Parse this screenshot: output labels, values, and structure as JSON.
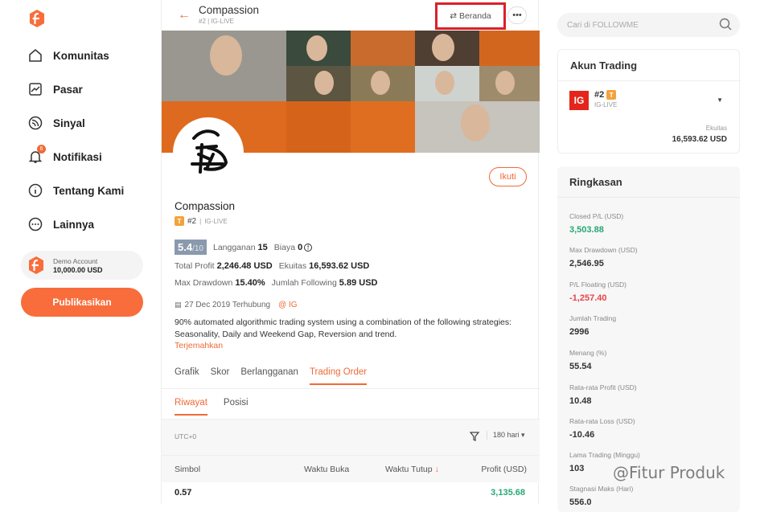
{
  "sidebar": {
    "items": [
      {
        "label": "Komunitas",
        "icon": "home-icon"
      },
      {
        "label": "Pasar",
        "icon": "chart-icon"
      },
      {
        "label": "Sinyal",
        "icon": "signal-icon"
      },
      {
        "label": "Notifikasi",
        "icon": "bell-icon",
        "badge": "6"
      },
      {
        "label": "Tentang Kami",
        "icon": "info-icon"
      },
      {
        "label": "Lainnya",
        "icon": "more-icon"
      }
    ],
    "demo_label": "Demo Account",
    "demo_value": "10,000.00 USD",
    "publish_label": "Publikasikan"
  },
  "header": {
    "title": "Compassion",
    "rank": "#2",
    "broker": "IG-LIVE",
    "home_label": "Beranda"
  },
  "profile": {
    "follow_label": "Ikuti",
    "name": "Compassion",
    "tier": "T",
    "rank": "#2",
    "broker": "IG-LIVE",
    "score": "5.4",
    "score_max": "/10",
    "subs_label": "Langganan",
    "subs_value": "15",
    "fee_label": "Biaya",
    "fee_value": "0",
    "total_profit_label": "Total Profit",
    "total_profit_value": "2,246.48 USD",
    "equity_label": "Ekuitas",
    "equity_value": "16,593.62 USD",
    "max_dd_label": "Max Drawdown",
    "max_dd_value": "15.40%",
    "following_label": "Jumlah Following",
    "following_value": "5.89 USD",
    "date_text": "27 Dec 2019 Terhubung",
    "ig_text": "@ IG",
    "description": "90% automated algorithmic trading system using a combination of the following strategies: Seasonality, Daily and Weekend Gap,  Reversion and trend.",
    "translate_label": "Terjemahkan"
  },
  "tabs": [
    "Grafik",
    "Skor",
    "Berlangganan",
    "Trading Order"
  ],
  "subtabs": [
    "Riwayat",
    "Posisi"
  ],
  "filter": {
    "timezone": "UTC+0",
    "period": "180 hari"
  },
  "table": {
    "headers": [
      "Simbol",
      "Waktu Buka",
      "Waktu Tutup",
      "Profit (USD)"
    ],
    "rows": [
      {
        "symbol": "0.57",
        "profit": "3,135.68"
      }
    ]
  },
  "right": {
    "search_placeholder": "Cari di FOLLOWME",
    "trading_account_title": "Akun Trading",
    "account_rank": "#2",
    "account_tier": "T",
    "account_broker": "IG-LIVE",
    "broker_logo": "IG",
    "equity_label": "Ekuitas",
    "equity_value": "16,593.62 USD",
    "summary_title": "Ringkasan",
    "metrics": [
      {
        "label": "Closed P/L (USD)",
        "value": "3,503.88",
        "color": "green"
      },
      {
        "label": "Max Drawdown (USD)",
        "value": "2,546.95",
        "color": ""
      },
      {
        "label": "P/L Floating (USD)",
        "value": "-1,257.40",
        "color": "red"
      },
      {
        "label": "Jumlah Trading",
        "value": "2996",
        "color": ""
      },
      {
        "label": "Menang (%)",
        "value": "55.54",
        "color": ""
      },
      {
        "label": "Rata-rata Profit (USD)",
        "value": "10.48",
        "color": ""
      },
      {
        "label": "Rata-rata Loss (USD)",
        "value": "-10.46",
        "color": ""
      },
      {
        "label": "Lama Trading (Minggu)",
        "value": "103",
        "color": ""
      },
      {
        "label": "Stagnasi Maks (Hari)",
        "value": "556.0",
        "color": ""
      }
    ]
  },
  "watermark": "@Fitur Produk"
}
